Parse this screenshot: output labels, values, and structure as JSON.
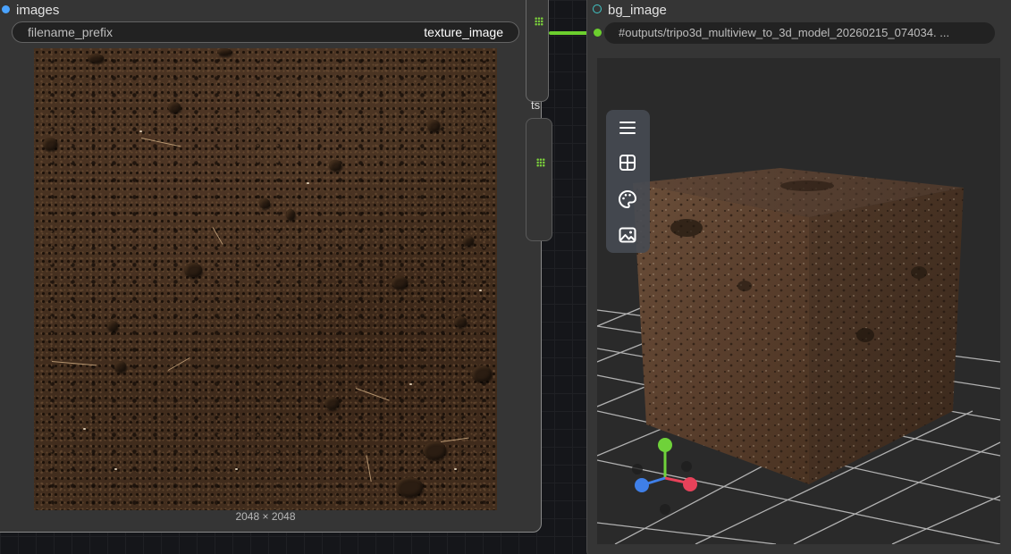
{
  "left_node": {
    "title": "images",
    "title_dot_color": "#4aa3ff",
    "widget": {
      "name": "filename_prefix",
      "value": "texture_image"
    },
    "image_dimensions": "2048 × 2048"
  },
  "middle_node": {
    "partial_label": "ts"
  },
  "right_node": {
    "title": "bg_image",
    "input_value": "#outputs/tripo3d_multiview_to_3d_model_20260215_074034. ...",
    "viewer_toolbar": [
      {
        "icon": "menu-icon"
      },
      {
        "icon": "grid-view-icon"
      },
      {
        "icon": "palette-icon"
      },
      {
        "icon": "image-icon"
      }
    ]
  },
  "colors": {
    "link_green": "#6ccf2e",
    "axis_x": "#e8425a",
    "axis_y": "#6fd23a",
    "axis_z": "#3f7fe8"
  }
}
